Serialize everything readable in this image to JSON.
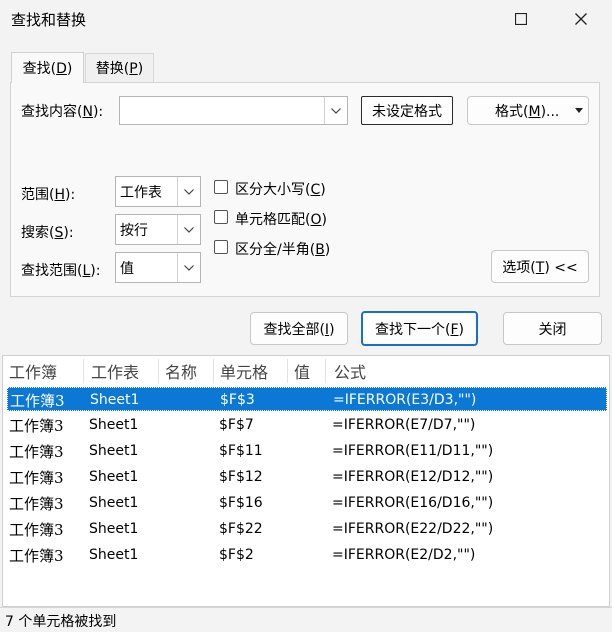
{
  "window": {
    "title": "查找和替换"
  },
  "tabs": [
    {
      "label": "查找",
      "key": "D",
      "active": true
    },
    {
      "label": "替换",
      "key": "P",
      "active": false
    }
  ],
  "find": {
    "label": "查找内容",
    "key": "N",
    "value": "",
    "no_format_label": "未设定格式",
    "format_button": "格式",
    "format_key": "M"
  },
  "options": {
    "scope_label": "范围",
    "scope_key": "H",
    "scope_value": "工作表",
    "search_label": "搜索",
    "search_key": "S",
    "search_value": "按行",
    "lookin_label": "查找范围",
    "lookin_key": "L",
    "lookin_value": "值",
    "match_case": "区分大小写",
    "match_case_key": "C",
    "match_cell": "单元格匹配",
    "match_cell_key": "O",
    "match_width": "区分全/半角",
    "match_width_key": "B",
    "options_button": "选项",
    "options_key": "T",
    "options_suffix": " <<"
  },
  "actions": {
    "find_all": "查找全部",
    "find_all_key": "I",
    "find_next": "查找下一个",
    "find_next_key": "F",
    "close": "关闭"
  },
  "results": {
    "columns": [
      "工作簿",
      "工作表",
      "名称",
      "单元格",
      "值",
      "公式"
    ],
    "rows": [
      {
        "book": "工作簿3",
        "sheet": "Sheet1",
        "name": "",
        "cell": "$F$3",
        "value": "",
        "formula": "=IFERROR(E3/D3,\"\")",
        "selected": true
      },
      {
        "book": "工作簿3",
        "sheet": "Sheet1",
        "name": "",
        "cell": "$F$7",
        "value": "",
        "formula": "=IFERROR(E7/D7,\"\")",
        "selected": false
      },
      {
        "book": "工作簿3",
        "sheet": "Sheet1",
        "name": "",
        "cell": "$F$11",
        "value": "",
        "formula": "=IFERROR(E11/D11,\"\")",
        "selected": false
      },
      {
        "book": "工作簿3",
        "sheet": "Sheet1",
        "name": "",
        "cell": "$F$12",
        "value": "",
        "formula": "=IFERROR(E12/D12,\"\")",
        "selected": false
      },
      {
        "book": "工作簿3",
        "sheet": "Sheet1",
        "name": "",
        "cell": "$F$16",
        "value": "",
        "formula": "=IFERROR(E16/D16,\"\")",
        "selected": false
      },
      {
        "book": "工作簿3",
        "sheet": "Sheet1",
        "name": "",
        "cell": "$F$22",
        "value": "",
        "formula": "=IFERROR(E22/D22,\"\")",
        "selected": false
      },
      {
        "book": "工作簿3",
        "sheet": "Sheet1",
        "name": "",
        "cell": "$F$2",
        "value": "",
        "formula": "=IFERROR(E2/D2,\"\")",
        "selected": false
      }
    ]
  },
  "status": {
    "text": "7 个单元格被找到"
  },
  "colors": {
    "accent": "#0a78d4",
    "focus_border": "#1a6fc4"
  },
  "icons": {
    "maximize": "maximize-icon",
    "close": "close-icon",
    "dropdown": "chevron-down-icon"
  }
}
